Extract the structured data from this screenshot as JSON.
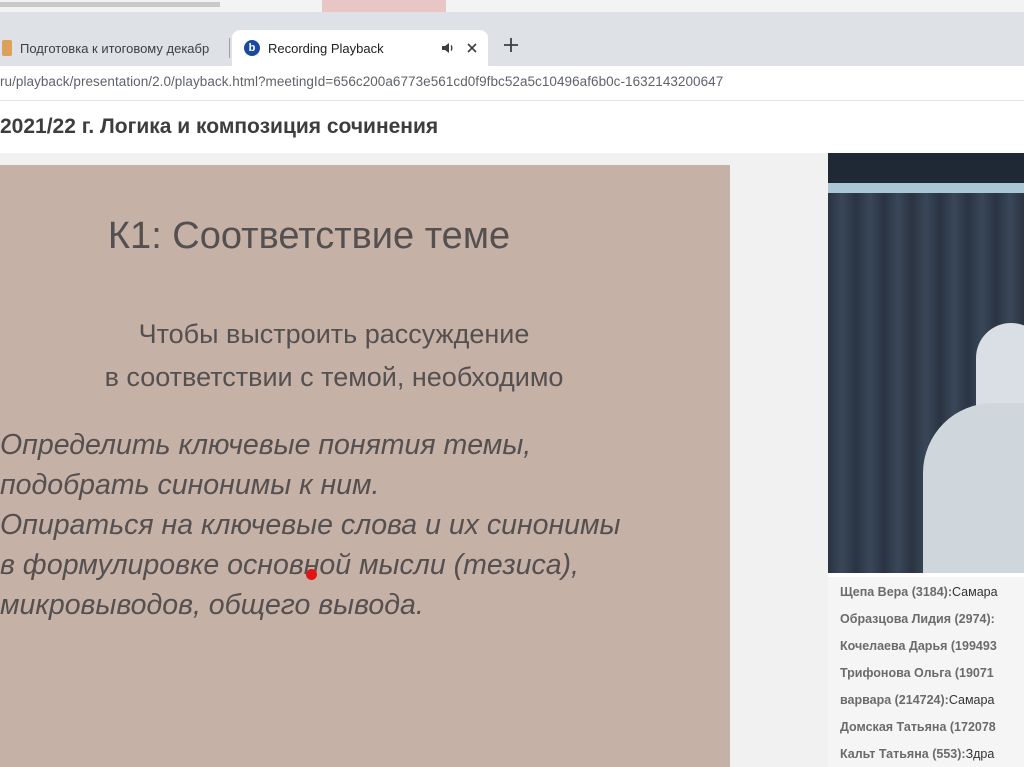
{
  "browser": {
    "tabs": [
      {
        "title": "Подготовка к итоговому декабр",
        "active": false
      },
      {
        "title": "Recording Playback",
        "active": true
      }
    ],
    "active_tab_favicon": "b",
    "url": "ru/playback/presentation/2.0/playback.html?meetingId=656c200a6773e561cd0f9fbc52a5c10496af6b0c-1632143200647"
  },
  "page": {
    "title": "2021/22 г. Логика и композиция сочинения"
  },
  "slide": {
    "title": "К1: Соответствие теме",
    "subtitle": [
      "Чтобы выстроить рассуждение",
      "в соответствии с темой, необходимо"
    ],
    "body": [
      "Определить ключевые понятия темы,",
      "подобрать синонимы к ним.",
      "Опираться на ключевые слова и их синонимы",
      "в формулировке основной мысли (тезиса),",
      "микровыводов, общего вывода."
    ]
  },
  "chat": {
    "messages": [
      {
        "author": "Щепа Вера (3184):",
        "text": "Самара"
      },
      {
        "author": "Образцова Лидия (2974):",
        "text": ""
      },
      {
        "author": "Кочелаева Дарья (199493",
        "text": ""
      },
      {
        "author": "Трифонова Ольга (19071",
        "text": ""
      },
      {
        "author": "варвара (214724):",
        "text": "Самара"
      },
      {
        "author": "Домская Татьяна (172078",
        "text": ""
      },
      {
        "author": "Кальт Татьяна (553):",
        "text": "Здра"
      }
    ]
  },
  "colors": {
    "slide_background": "#c6b1a7",
    "pointer": "#e01616",
    "tabstrip": "#dee1e6"
  }
}
